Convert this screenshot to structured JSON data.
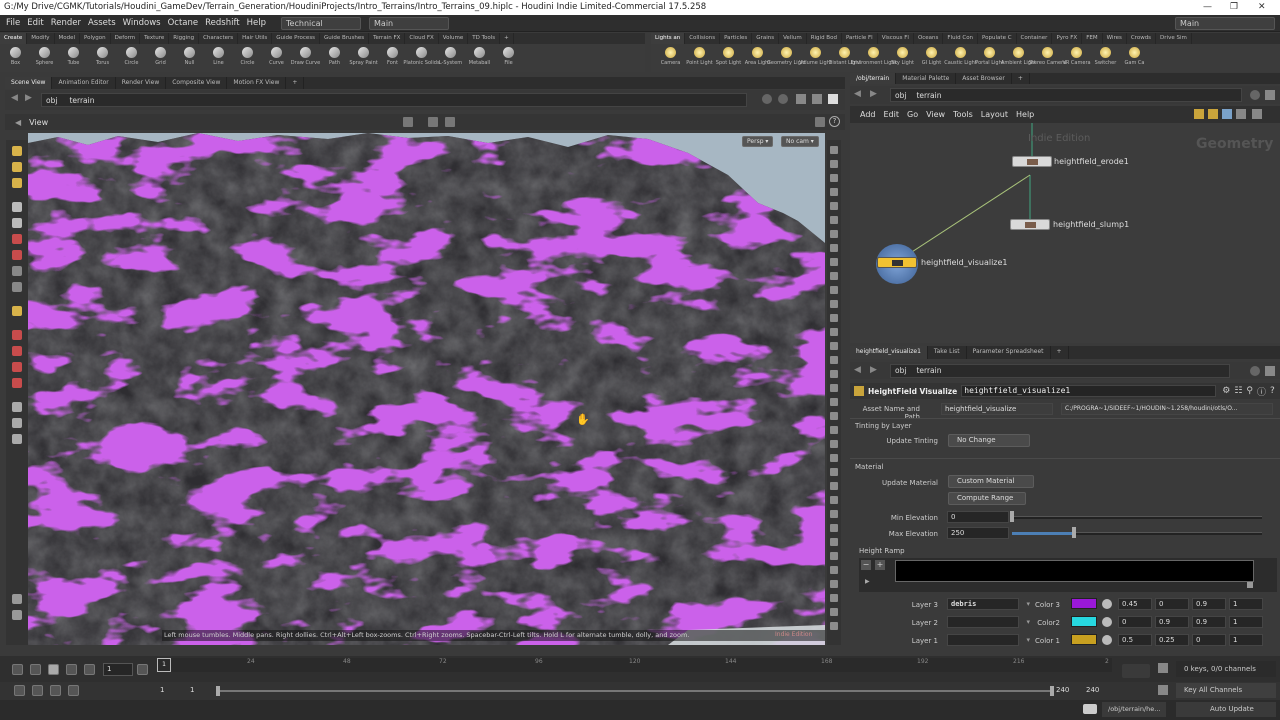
{
  "window": {
    "title": "G:/My Drive/CGMK/Tutorials/Houdini_GameDev/Terrain_Generation/HoudiniProjects/Intro_Terrains/Intro_Terrains_09.hiplc - Houdini Indie Limited-Commercial 17.5.258"
  },
  "menubar": {
    "items": [
      "File",
      "Edit",
      "Render",
      "Assets",
      "Windows",
      "Octane",
      "Redshift",
      "Help"
    ],
    "desktop": "Technical",
    "context": "Main",
    "right_context": "Main"
  },
  "shelf_left": {
    "tabs": [
      "Create",
      "Modify",
      "Model",
      "Polygon",
      "Deform",
      "Texture",
      "Rigging",
      "Characters",
      "Hair Utils",
      "Guide Process",
      "Guide Brushes",
      "Terrain FX",
      "Cloud FX",
      "Volume",
      "TD Tools"
    ],
    "tools": [
      "Box",
      "Sphere",
      "Tube",
      "Torus",
      "Circle",
      "Grid",
      "Null",
      "Line",
      "Circle",
      "Curve",
      "Draw Curve",
      "Path",
      "Spray Paint",
      "Font",
      "Platonic Solids",
      "L-System",
      "Metaball",
      "File"
    ]
  },
  "shelf_right": {
    "tabs": [
      "Lights an",
      "Collisions",
      "Particles",
      "Grains",
      "Vellum",
      "Rigid Bod",
      "Particle Fl",
      "Viscous Fl",
      "Oceans",
      "Fluid Con",
      "Populate C",
      "Container",
      "Pyro FX",
      "FEM",
      "Wires",
      "Crowds",
      "Drive Sim"
    ],
    "tools": [
      "Camera",
      "Point Light",
      "Spot Light",
      "Area Light",
      "Geometry Light",
      "Volume Light",
      "Distant Light",
      "Environment Light",
      "Sky Light",
      "GI Light",
      "Caustic Light",
      "Portal Light",
      "Ambient Light",
      "Stereo Camera",
      "VR Camera",
      "Switcher",
      "Gam Ca"
    ]
  },
  "viewer": {
    "tabs": [
      "Scene View",
      "Animation Editor",
      "Render View",
      "Composite View",
      "Motion FX View"
    ],
    "path": [
      "obj",
      "terrain"
    ],
    "title": "View",
    "persp": "Persp ▾",
    "cam": "No cam ▾",
    "status": "Left mouse tumbles. Middle pans. Right dollies. Ctrl+Alt+Left box-zooms. Ctrl+Right zooms. Spacebar-Ctrl-Left tilts. Hold L for alternate tumble, dolly, and zoom.",
    "badge": "Indie Edition"
  },
  "network": {
    "tabs": [
      "/obj/terrain",
      "Material Palette",
      "Asset Browser"
    ],
    "path": [
      "obj",
      "terrain"
    ],
    "menu": [
      "Add",
      "Edit",
      "Go",
      "View",
      "Tools",
      "Layout",
      "Help"
    ],
    "watermark": "Indie Edition",
    "context_label": "Geometry",
    "nodes": [
      "heightfield_erode1",
      "heightfield_slump1",
      "heightfield_visualize1"
    ]
  },
  "params": {
    "tabs": [
      "heightfield_visualize1",
      "Take List",
      "Parameter Spreadsheet"
    ],
    "path": [
      "obj",
      "terrain"
    ],
    "node_type": "HeightField Visualize",
    "node_name": "heightfield_visualize1",
    "asset_label": "Asset Name and Path",
    "asset_name": "heightfield_visualize",
    "asset_path": "C:/PROGRA~1/SIDEEF~1/HOUDIN~1.258/houdini/otls/O...",
    "tinting_section": "Tinting by Layer",
    "update_tinting_label": "Update Tinting",
    "update_tinting_value": "No Change",
    "material_section": "Material",
    "update_material_label": "Update Material",
    "update_material_value": "Custom Material",
    "compute_range": "Compute Range",
    "min_elev_label": "Min Elevation",
    "min_elev": "0",
    "max_elev_label": "Max Elevation",
    "max_elev": "250",
    "height_ramp": "Height Ramp",
    "layers": [
      {
        "label": "Layer 3",
        "value": "debris",
        "color_label": "Color 3",
        "color": "#9a18d8",
        "r": "0.45",
        "g": "0",
        "b": "0.9",
        "a": "1"
      },
      {
        "label": "Layer 2",
        "value": "",
        "color_label": "Color2",
        "color": "#27d8e0",
        "r": "0",
        "g": "0.9",
        "b": "0.9",
        "a": "1"
      },
      {
        "label": "Layer 1",
        "value": "",
        "color_label": "Color 1",
        "color": "#c8a020",
        "r": "0.5",
        "g": "0.25",
        "b": "0",
        "a": "1"
      }
    ]
  },
  "timeline": {
    "frame": "1",
    "ticks": [
      "24",
      "48",
      "72",
      "96",
      "120",
      "144",
      "168",
      "192",
      "216",
      "2"
    ],
    "start": "1",
    "start2": "1",
    "end": "240",
    "end2": "240",
    "keys": "0 keys, 0/0 channels",
    "key_all": "Key All Channels",
    "status_path": "/obj/terrain/he...",
    "auto_update": "Auto Update"
  },
  "colors": {
    "accent_purple": "#9a18d8"
  }
}
